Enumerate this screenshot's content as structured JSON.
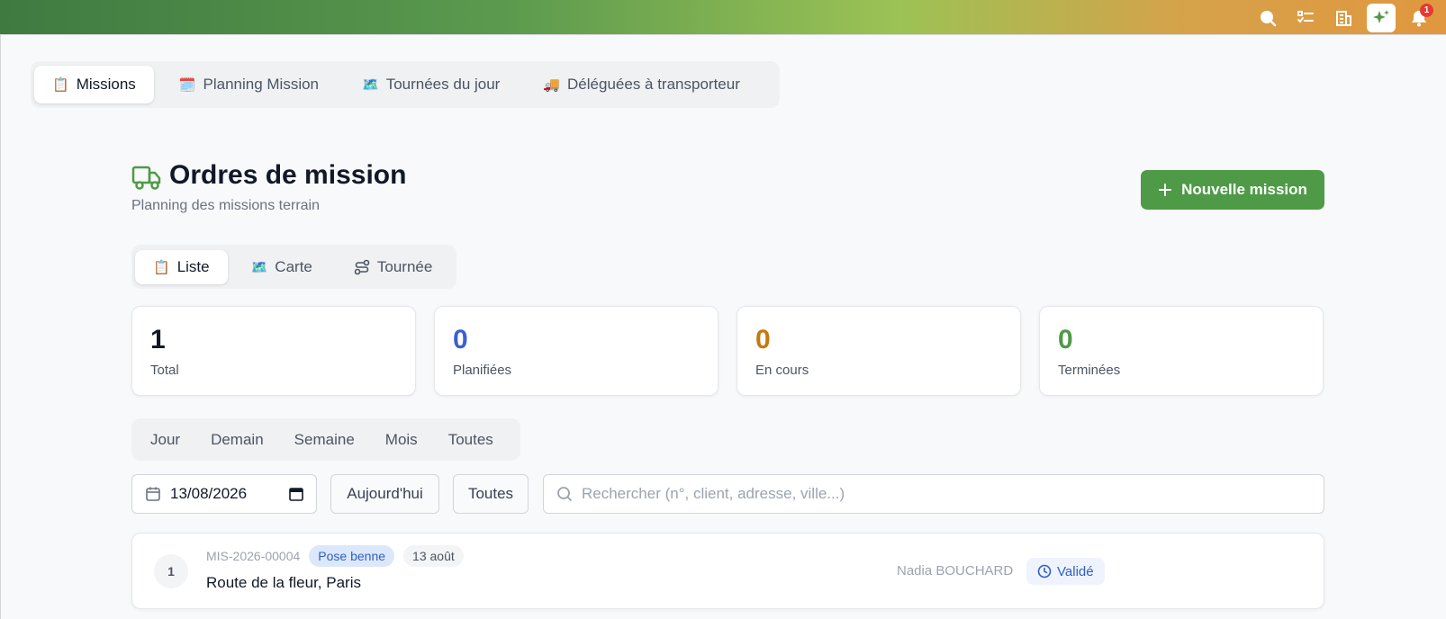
{
  "topbar": {
    "icons": [
      "search-icon",
      "checklist-icon",
      "building-icon",
      "sparkles-icon",
      "bell-icon"
    ],
    "notifications_count": "1",
    "colors": {
      "gradient_start": "#3f7a41",
      "gradient_mid": "#9cc255",
      "gradient_end": "#e0973f"
    }
  },
  "main_tabs": [
    {
      "emoji": "📋",
      "label": "Missions",
      "active": true
    },
    {
      "emoji": "🗓️",
      "label": "Planning Mission",
      "active": false
    },
    {
      "emoji": "🗺️",
      "label": "Tournées du jour",
      "active": false
    },
    {
      "emoji": "🚚",
      "label": "Déléguées à transporteur",
      "active": false
    }
  ],
  "header": {
    "title": "Ordres de mission",
    "subtitle": "Planning des missions terrain",
    "new_button_label": "Nouvelle mission",
    "accent_color": "#4f9a46"
  },
  "view_tabs": [
    {
      "emoji": "📋",
      "label": "Liste",
      "active": true
    },
    {
      "emoji": "🗺️",
      "label": "Carte",
      "active": false
    },
    {
      "icon": "route-icon",
      "label": "Tournée",
      "active": false
    }
  ],
  "stats": [
    {
      "value": "1",
      "label": "Total",
      "color": "#111827"
    },
    {
      "value": "0",
      "label": "Planifiées",
      "color": "#3b5fd4"
    },
    {
      "value": "0",
      "label": "En cours",
      "color": "#c27a12"
    },
    {
      "value": "0",
      "label": "Terminées",
      "color": "#4f9a46"
    }
  ],
  "period_tabs": [
    "Jour",
    "Demain",
    "Semaine",
    "Mois",
    "Toutes"
  ],
  "filters": {
    "date_value": "13/08/2026",
    "today_button": "Aujourd'hui",
    "status_select": "Toutes",
    "search_placeholder": "Rechercher (n°, client, adresse, ville...)"
  },
  "missions": [
    {
      "index": "1",
      "reference": "MIS-2026-00004",
      "type": "Pose benne",
      "date": "13 août",
      "address": "Route de la fleur, Paris",
      "assignee": "Nadia BOUCHARD",
      "status": "Validé"
    }
  ]
}
